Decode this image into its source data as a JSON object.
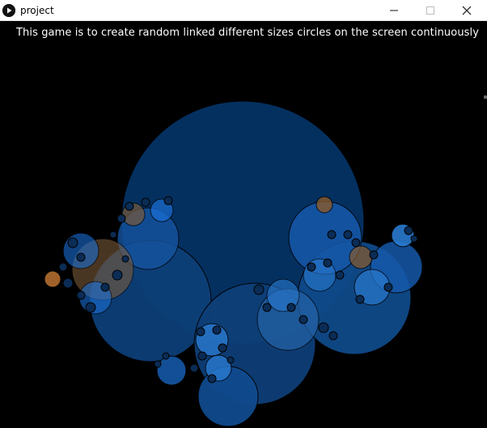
{
  "window": {
    "title": "project",
    "app_icon": "play-icon",
    "controls": {
      "minimize_icon": "minimize-icon",
      "maximize_icon": "maximize-icon",
      "close_icon": "close-icon"
    }
  },
  "canvas": {
    "caption": "This game is to create random linked different sizes circles on the screen continuously",
    "background": "#000000",
    "colors": {
      "large_circle": "#043060",
      "medium_circle": "#0f4a8a",
      "bright_circle": "#1a6fd6",
      "accent_orange": "#8a5a2a",
      "outline": "#000000"
    }
  }
}
